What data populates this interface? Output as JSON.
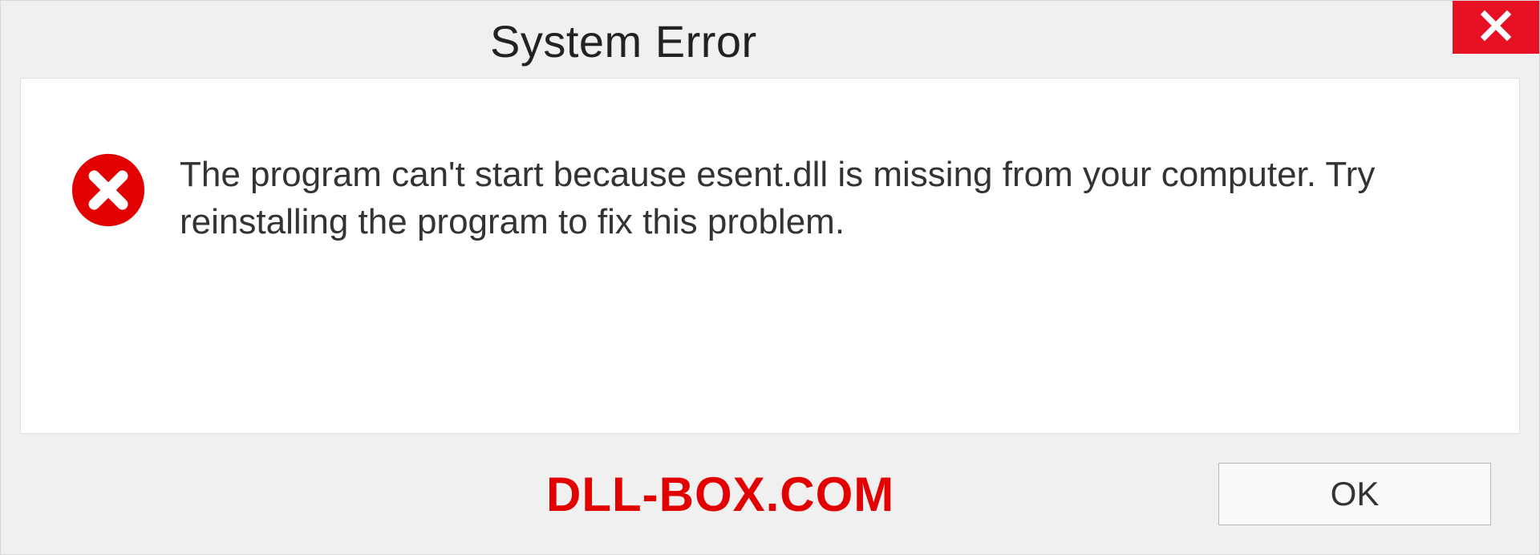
{
  "dialog": {
    "title": "System Error",
    "message": "The program can't start because esent.dll is missing from your computer. Try reinstalling the program to fix this problem.",
    "ok_label": "OK"
  },
  "watermark": "DLL-BOX.COM",
  "colors": {
    "close_bg": "#e81123",
    "error_red": "#e20000"
  }
}
